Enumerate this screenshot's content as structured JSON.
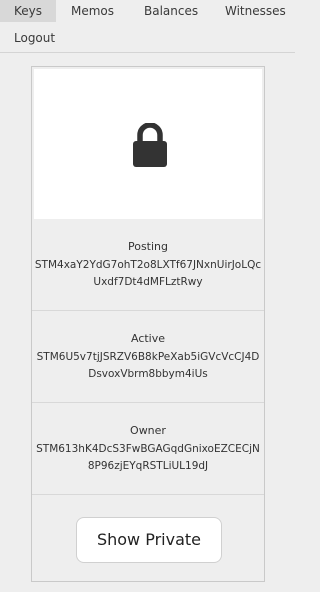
{
  "nav": {
    "tabs": [
      "Keys",
      "Memos",
      "Balances",
      "Witnesses"
    ],
    "logout": "Logout",
    "active_tab": "Keys"
  },
  "lock": {
    "icon": "lock-icon"
  },
  "keys": [
    {
      "label": "Posting",
      "value": "STM4xaY2YdG7ohT2o8LXTf67JNxnUirJoLQcUxdf7Dt4dMFLztRwy"
    },
    {
      "label": "Active",
      "value": "STM6U5v7tjJSRZV6B8kPeXab5iGVcVcCJ4DDsvoxVbrm8bbym4iUs"
    },
    {
      "label": "Owner",
      "value": "STM613hK4DcS3FwBGAGqdGnixoEZCECjN8P96zjEYqRSTLiUL19dJ"
    }
  ],
  "show_private_label": "Show Private"
}
